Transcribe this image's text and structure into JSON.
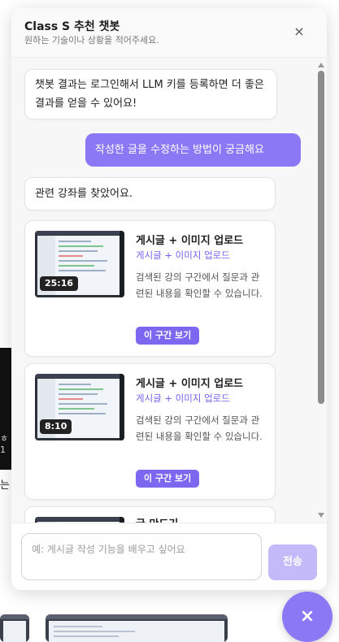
{
  "background": {
    "fragment_time": "",
    "fragment_text": "는"
  },
  "chatbot": {
    "title": "Class S 추천 챗봇",
    "subtitle": "원하는 기술이나 상황을 적어주세요.",
    "close_icon": "×"
  },
  "messages": {
    "bot_login_notice": "챗봇 결과는 로그인해서 LLM 키를 등록하면 더 좋은 결과를 얻을 수 있어요!",
    "user_query": "작성한 글을 수정하는 방법이 궁금해요",
    "bot_found": "관련 강좌를 찾았어요."
  },
  "results": [
    {
      "duration": "25:16",
      "title": "게시글 + 이미지 업로드",
      "subtitle": "게시글 + 이미지 업로드",
      "description": "검색된 강의 구간에서 질문과 관련된 내용을 확인할 수 있습니다.",
      "button": "이 구간 보기"
    },
    {
      "duration": "8:10",
      "title": "게시글 + 이미지 업로드",
      "subtitle": "게시글 + 이미지 업로드",
      "description": "검색된 강의 구간에서 질문과 관련된 내용을 확인할 수 있습니다.",
      "button": "이 구간 보기"
    },
    {
      "title": "글 만드기"
    }
  ],
  "composer": {
    "placeholder": "예: 게시글 작성 기능을 배우고 싶어요",
    "send_label": "전송"
  },
  "fab": {
    "icon": "×"
  },
  "colors": {
    "accent": "#8b78f5",
    "button": "#7c67f0",
    "send_disabled": "#c4baf9"
  }
}
